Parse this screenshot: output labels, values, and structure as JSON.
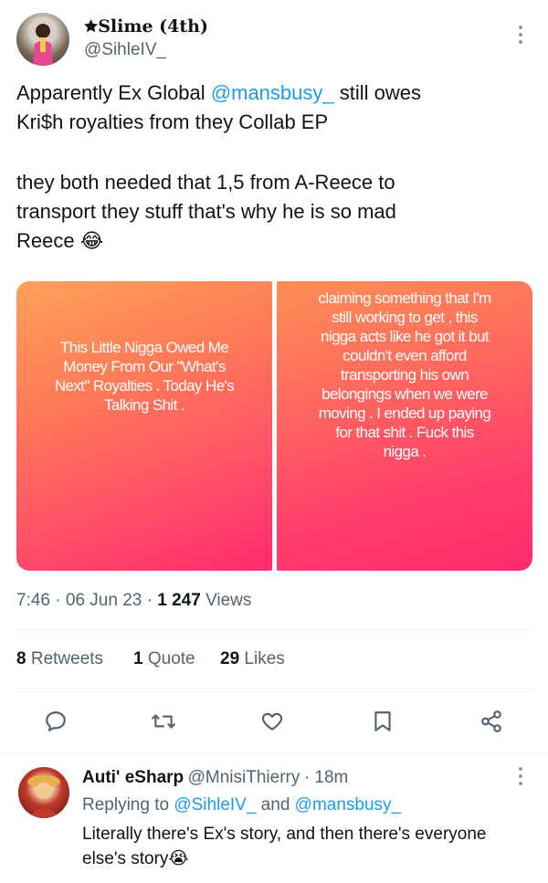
{
  "tweet": {
    "display_name": "🟊Slime (4th)",
    "handle": "@SihleIV_",
    "text_before_mention": "Apparently Ex Global ",
    "mention": "@mansbusy_",
    "text_after_mention": " still owes\nKri$h royalties from they Collab EP",
    "text_p2": " they both needed that 1,5 from A-Reece to\ntransport they stuff that's why he is so mad\nReece 😂",
    "story_left": "This Little Nigga Owed Me\nMoney From Our \"What's\nNext\" Royalties . Today He's\nTalking Shit .",
    "story_right": "claiming something that I'm\nstill working to get , this\nnigga acts like he got it but\ncouldn't even afford\ntransporting his own\nbelongings when we were\nmoving . I ended up paying\nfor that shit . Fuck this\nnigga .",
    "time": "7:46",
    "date": "06 Jun 23",
    "views_count": "1 247",
    "views_label": "Views",
    "retweets_count": "8",
    "retweets_label": "Retweets",
    "quotes_count": "1",
    "quotes_label": "Quote",
    "likes_count": "29",
    "likes_label": "Likes"
  },
  "actions": [
    "reply-icon",
    "retweet-icon",
    "like-icon",
    "bookmark-icon",
    "share-icon"
  ],
  "reply": {
    "display_name": "Auti' eSharp",
    "handle": "@MnisiThierry",
    "time": "· 18m",
    "replying_prefix": "Replying to ",
    "replying_user1": "@SihleIV_",
    "replying_and": " and ",
    "replying_user2": "@mansbusy_",
    "text": "Literally there's Ex's story, and then there's everyone\nelse's story😭"
  },
  "colors": {
    "accent": "#1d9bf0",
    "text_primary": "#0f1419",
    "text_secondary": "#536471",
    "story_gradient_top": "#ff8a4c",
    "story_gradient_bottom": "#ff2a6d"
  }
}
